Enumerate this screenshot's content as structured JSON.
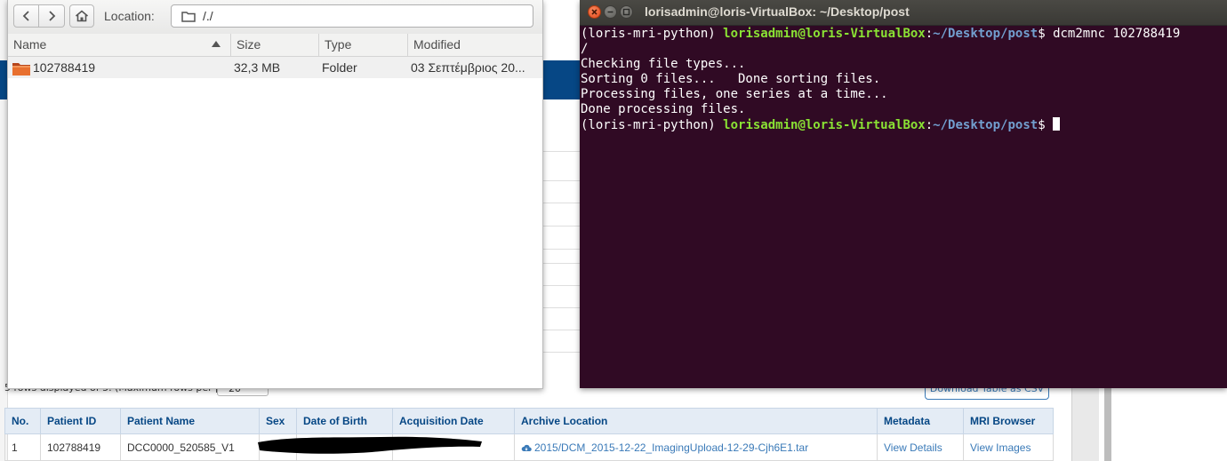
{
  "files": {
    "location_label": "Location:",
    "location_value": "/./",
    "columns": [
      "Name",
      "Size",
      "Type",
      "Modified"
    ],
    "rows": [
      {
        "name": "102788419",
        "size": "32,3 MB",
        "type": "Folder",
        "modified": "03 Σεπτέμβριος 20..."
      }
    ]
  },
  "terminal": {
    "title": "lorisadmin@loris-VirtualBox: ~/Desktop/post",
    "env": "(loris-mri-python)",
    "user_host": "lorisadmin@loris-VirtualBox",
    "path": "~/Desktop/post",
    "prompt_symbol": "$",
    "command": "dcm2mnc 102788419",
    "command_wrap": "/",
    "output": [
      "Checking file types...",
      "Sorting 0 files...   Done sorting files.",
      "Processing files, one series at a time...",
      "Done processing files."
    ],
    "colors": {
      "background": "#300a24",
      "user": "#8ae234",
      "path": "#729fcf"
    }
  },
  "browser": {
    "rows_info": "5 rows displayed of 5. (Maximum rows per page:",
    "rows_per_page": "20",
    "download_label": "Download Table as CSV",
    "accent_color": "#064785",
    "table": {
      "headers": [
        "No.",
        "Patient ID",
        "Patient Name",
        "Sex",
        "Date of Birth",
        "Acquisition Date",
        "Archive Location",
        "Metadata",
        "MRI Browser"
      ],
      "rows": [
        {
          "no": "1",
          "patient_id": "102788419",
          "patient_name": "DCC0000_520585_V1",
          "sex": "",
          "dob": "",
          "acq_date": "",
          "archive_location": "2015/DCM_2015-12-22_ImagingUpload-12-29-Cjh6E1.tar",
          "metadata": "View Details",
          "mri_browser": "View Images"
        }
      ]
    }
  }
}
